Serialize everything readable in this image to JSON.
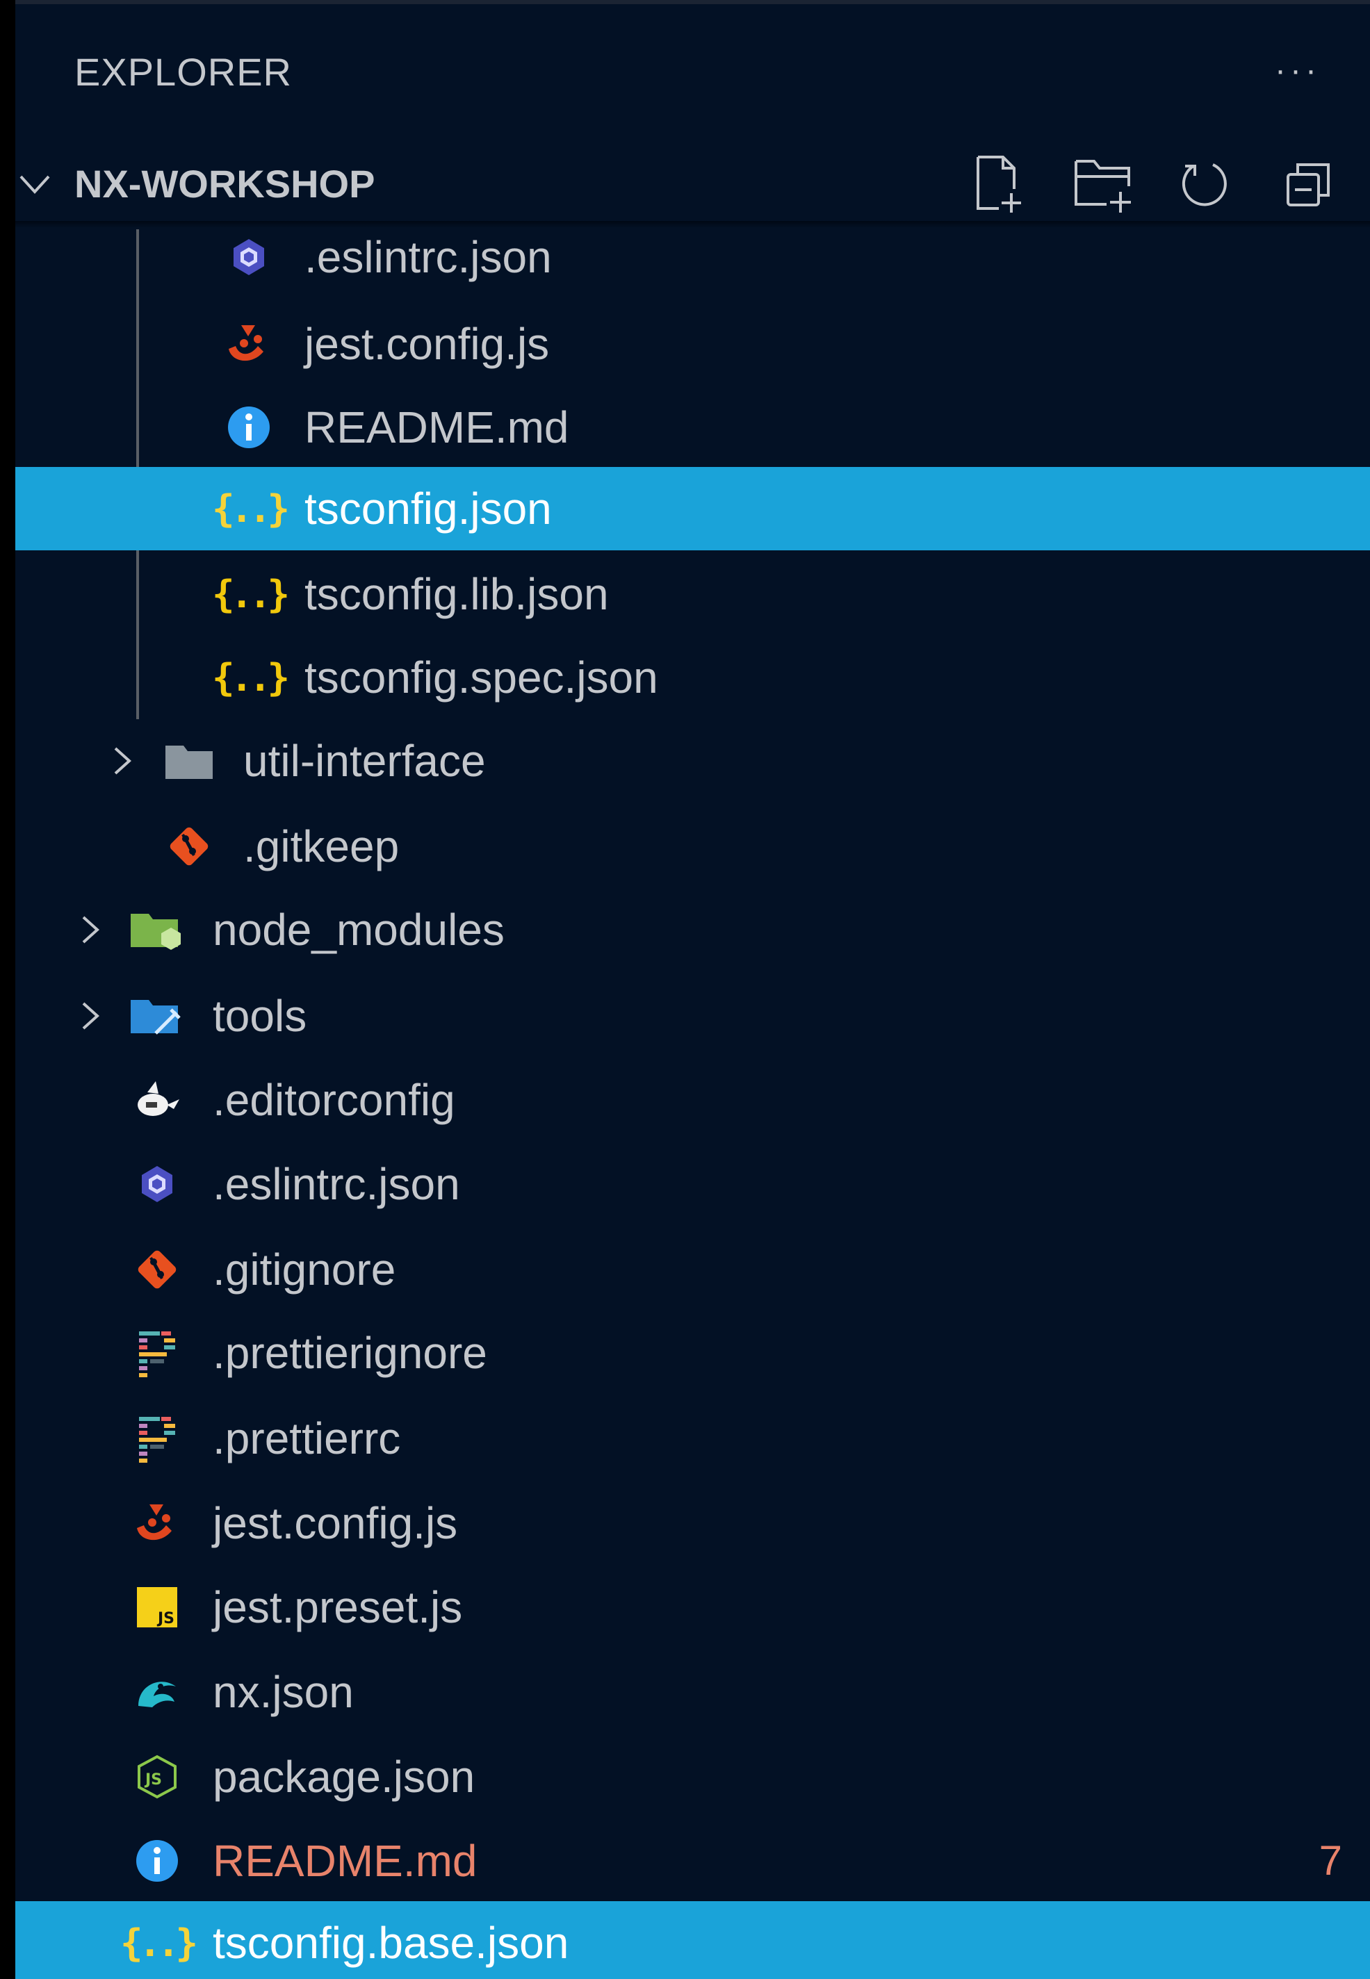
{
  "explorer": {
    "title": "EXPLORER",
    "more_label": "···",
    "section_title": "NX-WORKSHOP",
    "actions": [
      "new-file-icon",
      "new-folder-icon",
      "refresh-icon",
      "collapse-all-icon"
    ]
  },
  "colors": {
    "background": "#031125",
    "selected_row": "#1aa3d9",
    "text": "#c4c7cc",
    "modified_text": "#e8836b",
    "json_icon": "#f1c80c"
  },
  "tree": [
    {
      "label": ".eslintrc.json",
      "icon": "eslint-icon",
      "kind": "file"
    },
    {
      "label": "jest.config.js",
      "icon": "jest-icon",
      "kind": "file"
    },
    {
      "label": "README.md",
      "icon": "info-icon",
      "kind": "file"
    },
    {
      "label": "tsconfig.json",
      "icon": "json-icon",
      "kind": "file",
      "selected": true
    },
    {
      "label": "tsconfig.lib.json",
      "icon": "json-icon",
      "kind": "file"
    },
    {
      "label": "tsconfig.spec.json",
      "icon": "json-icon",
      "kind": "file"
    },
    {
      "label": "util-interface",
      "icon": "folder-icon",
      "kind": "folder",
      "expanded": false
    },
    {
      "label": ".gitkeep",
      "icon": "git-icon",
      "kind": "file"
    },
    {
      "label": "node_modules",
      "icon": "node-folder-icon",
      "kind": "folder",
      "expanded": false
    },
    {
      "label": "tools",
      "icon": "tools-folder-icon",
      "kind": "folder",
      "expanded": false
    },
    {
      "label": ".editorconfig",
      "icon": "editorconfig-icon",
      "kind": "file"
    },
    {
      "label": ".eslintrc.json",
      "icon": "eslint-icon",
      "kind": "file"
    },
    {
      "label": ".gitignore",
      "icon": "git-icon",
      "kind": "file"
    },
    {
      "label": ".prettierignore",
      "icon": "prettier-icon",
      "kind": "file"
    },
    {
      "label": ".prettierrc",
      "icon": "prettier-icon",
      "kind": "file"
    },
    {
      "label": "jest.config.js",
      "icon": "jest-icon",
      "kind": "file"
    },
    {
      "label": "jest.preset.js",
      "icon": "js-icon",
      "kind": "file"
    },
    {
      "label": "nx.json",
      "icon": "nx-icon",
      "kind": "file"
    },
    {
      "label": "package.json",
      "icon": "nodejs-icon",
      "kind": "file"
    },
    {
      "label": "README.md",
      "icon": "info-icon",
      "kind": "file",
      "modified": true,
      "badge": "7"
    },
    {
      "label": "tsconfig.base.json",
      "icon": "json-icon",
      "kind": "file",
      "selected": true
    }
  ]
}
